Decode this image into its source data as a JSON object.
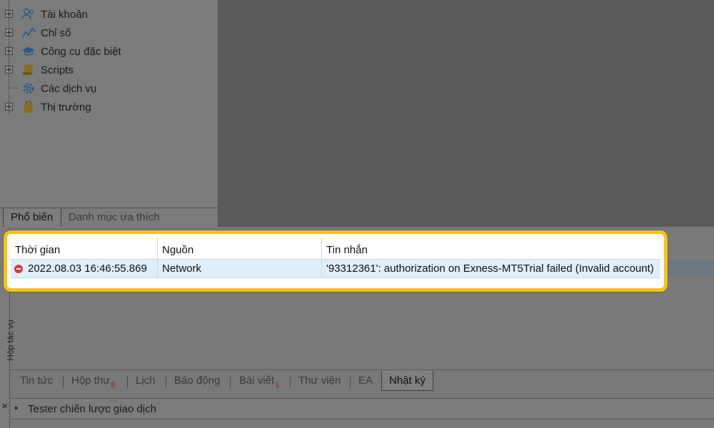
{
  "navigator": {
    "items": [
      {
        "label": "Tài khoản",
        "icon": "accounts-icon",
        "expandable": true
      },
      {
        "label": "Chỉ số",
        "icon": "indicators-icon",
        "expandable": true
      },
      {
        "label": "Công cụ đặc biệt",
        "icon": "expert-advisors-icon",
        "expandable": true
      },
      {
        "label": "Scripts",
        "icon": "scripts-icon",
        "expandable": true
      },
      {
        "label": "Các dịch vụ",
        "icon": "services-icon",
        "expandable": false
      },
      {
        "label": "Thị trường",
        "icon": "market-icon",
        "expandable": true
      }
    ],
    "tabs": {
      "common": "Phổ biến",
      "favorites": "Danh mục ưa thích"
    }
  },
  "journal": {
    "columns": {
      "time": "Thời gian",
      "source": "Nguồn",
      "message": "Tin nhắn"
    },
    "rows": [
      {
        "time": "2022.08.03 16:46:55.869",
        "source": "Network",
        "message": "'93312361': authorization on Exness-MT5Trial failed (Invalid account)",
        "level": "error"
      }
    ]
  },
  "toolbox": {
    "side_label": "Hộp tác vụ",
    "tabs": [
      {
        "label": "Tin tức",
        "badge": ""
      },
      {
        "label": "Hộp thư",
        "badge": "8"
      },
      {
        "label": "Lịch",
        "badge": ""
      },
      {
        "label": "Báo động",
        "badge": ""
      },
      {
        "label": "Bài viết",
        "badge": "1"
      },
      {
        "label": "Thư viện",
        "badge": ""
      },
      {
        "label": "EA",
        "badge": ""
      },
      {
        "label": "Nhật ký",
        "badge": ""
      }
    ],
    "active_tab": "Nhật ký",
    "tester": {
      "bullet": "•",
      "label": "Tester chiến lược giao dịch",
      "close": "✕"
    }
  },
  "colors": {
    "highlight": "#f5c21b",
    "selected_row": "#dfeefb",
    "error": "#d83a3a"
  }
}
